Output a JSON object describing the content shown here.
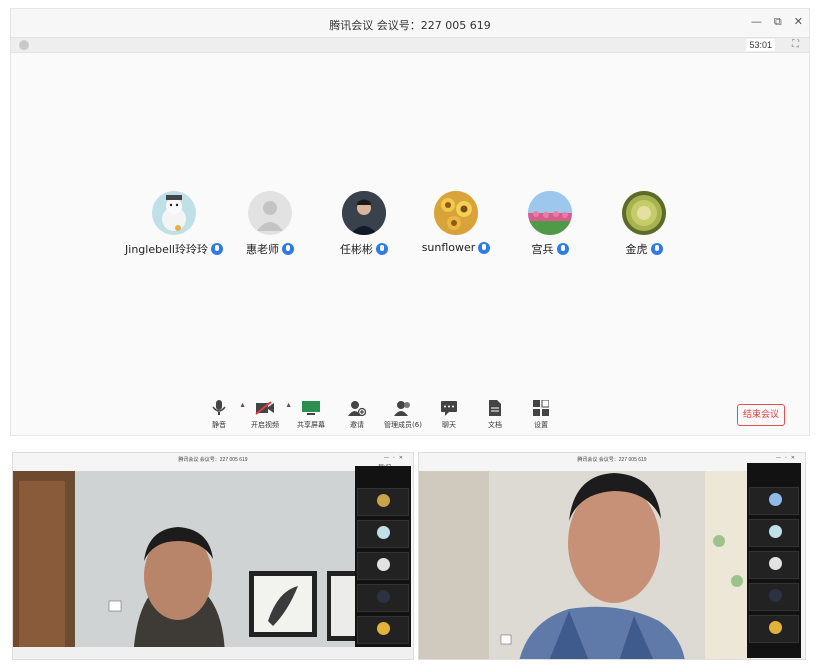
{
  "main": {
    "title": "腾讯会议 会议号：227 005 619",
    "window_controls": [
      "—",
      "⧉",
      "✕"
    ],
    "timer": "53:01",
    "participants": [
      {
        "name": "Jinglebell玲玲玲",
        "avatar": "snowman-avatar",
        "color": "#bfe0e6"
      },
      {
        "name": "惠老师",
        "avatar": "default-person-avatar",
        "color": "#e2e2e2"
      },
      {
        "name": "任彬彬",
        "avatar": "man-photo-avatar",
        "color": "#2b3340"
      },
      {
        "name": "sunflower",
        "avatar": "sunflower-avatar",
        "color": "#e2b23a"
      },
      {
        "name": "宫兵",
        "avatar": "tulip-field-avatar",
        "color": "#8fbbe6"
      },
      {
        "name": "金虎",
        "avatar": "cactus-avatar",
        "color": "#9aa64a"
      }
    ],
    "toolbar": [
      {
        "label": "静音",
        "icon": "microphone-icon"
      },
      {
        "label": "开启视频",
        "icon": "video-off-icon"
      },
      {
        "label": "共享屏幕",
        "icon": "share-screen-icon"
      },
      {
        "label": "邀请",
        "icon": "invite-user-icon"
      },
      {
        "label": "管理成员(6)",
        "icon": "members-icon"
      },
      {
        "label": "聊天",
        "icon": "chat-icon"
      },
      {
        "label": "文档",
        "icon": "document-icon"
      },
      {
        "label": "设置",
        "icon": "settings-icon"
      }
    ],
    "end_button": "结束会议"
  },
  "left_window": {
    "title": "腾讯会议 会议号：227 005 619",
    "timer": "55:42"
  },
  "right_window": {
    "title": "腾讯会议 会议号：227 005 619"
  }
}
